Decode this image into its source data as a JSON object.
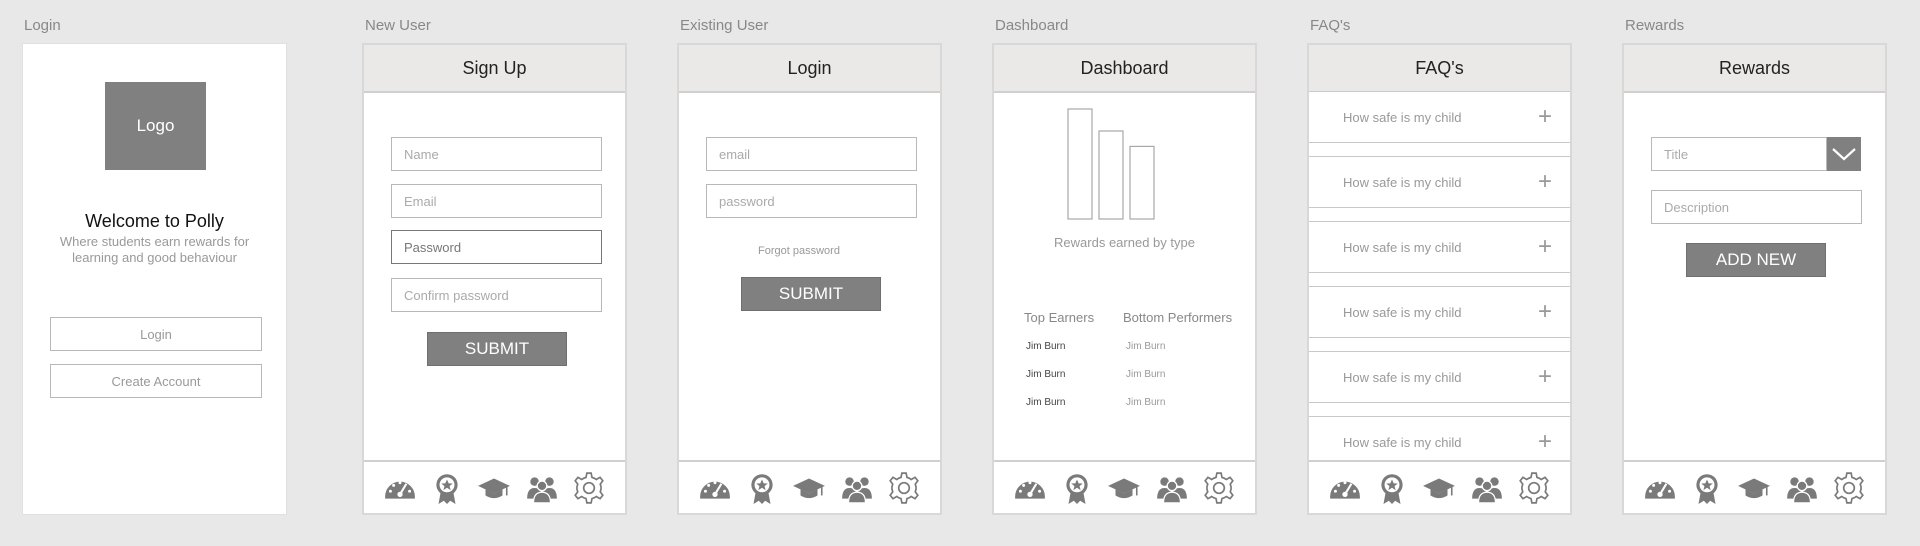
{
  "artboards": {
    "login_label": "Login",
    "new_user_label": "New User",
    "existing_user_label": "Existing User",
    "dashboard_label": "Dashboard",
    "faqs_label": "FAQ's",
    "rewards_label": "Rewards"
  },
  "welcome": {
    "logo_text": "Logo",
    "title": "Welcome to Polly",
    "subtitle_line1": "Where students earn rewards for",
    "subtitle_line2": "learning and good behaviour",
    "login_button": "Login",
    "create_account_button": "Create Account"
  },
  "signup": {
    "header": "Sign Up",
    "name_placeholder": "Name",
    "email_placeholder": "Email",
    "password_value": "Password",
    "confirm_placeholder": "Confirm password",
    "submit": "SUBMIT"
  },
  "login": {
    "header": "Login",
    "email_placeholder": "email",
    "password_placeholder": "password",
    "forgot": "Forgot password",
    "submit": "SUBMIT"
  },
  "dashboard": {
    "header": "Dashboard",
    "chart_caption": "Rewards earned by type",
    "top_head": "Top Earners",
    "bottom_head": "Bottom Performers",
    "top_rows": [
      "Jim Burn",
      "Jim Burn",
      "Jim Burn"
    ],
    "bottom_rows": [
      "Jim Burn",
      "Jim Burn",
      "Jim Burn"
    ]
  },
  "chart_data": {
    "type": "bar",
    "categories": [
      "",
      "",
      ""
    ],
    "values": [
      100,
      80,
      66
    ],
    "title": "Rewards earned by type",
    "ylim": [
      0,
      100
    ]
  },
  "faqs": {
    "header": "FAQ's",
    "items": [
      "How safe is my child",
      "How safe is my child",
      "How safe is my child",
      "How safe is my child",
      "How safe is my child",
      "How safe is my child"
    ],
    "plus": "+"
  },
  "rewards": {
    "header": "Rewards",
    "title_placeholder": "Title",
    "description_placeholder": "Description",
    "add_new": "ADD NEW"
  },
  "icons": {
    "tabs": [
      "dashboard-gauge-icon",
      "award-ribbon-icon",
      "graduation-cap-icon",
      "users-group-icon",
      "gear-icon"
    ],
    "color": "#7a7a7a"
  }
}
